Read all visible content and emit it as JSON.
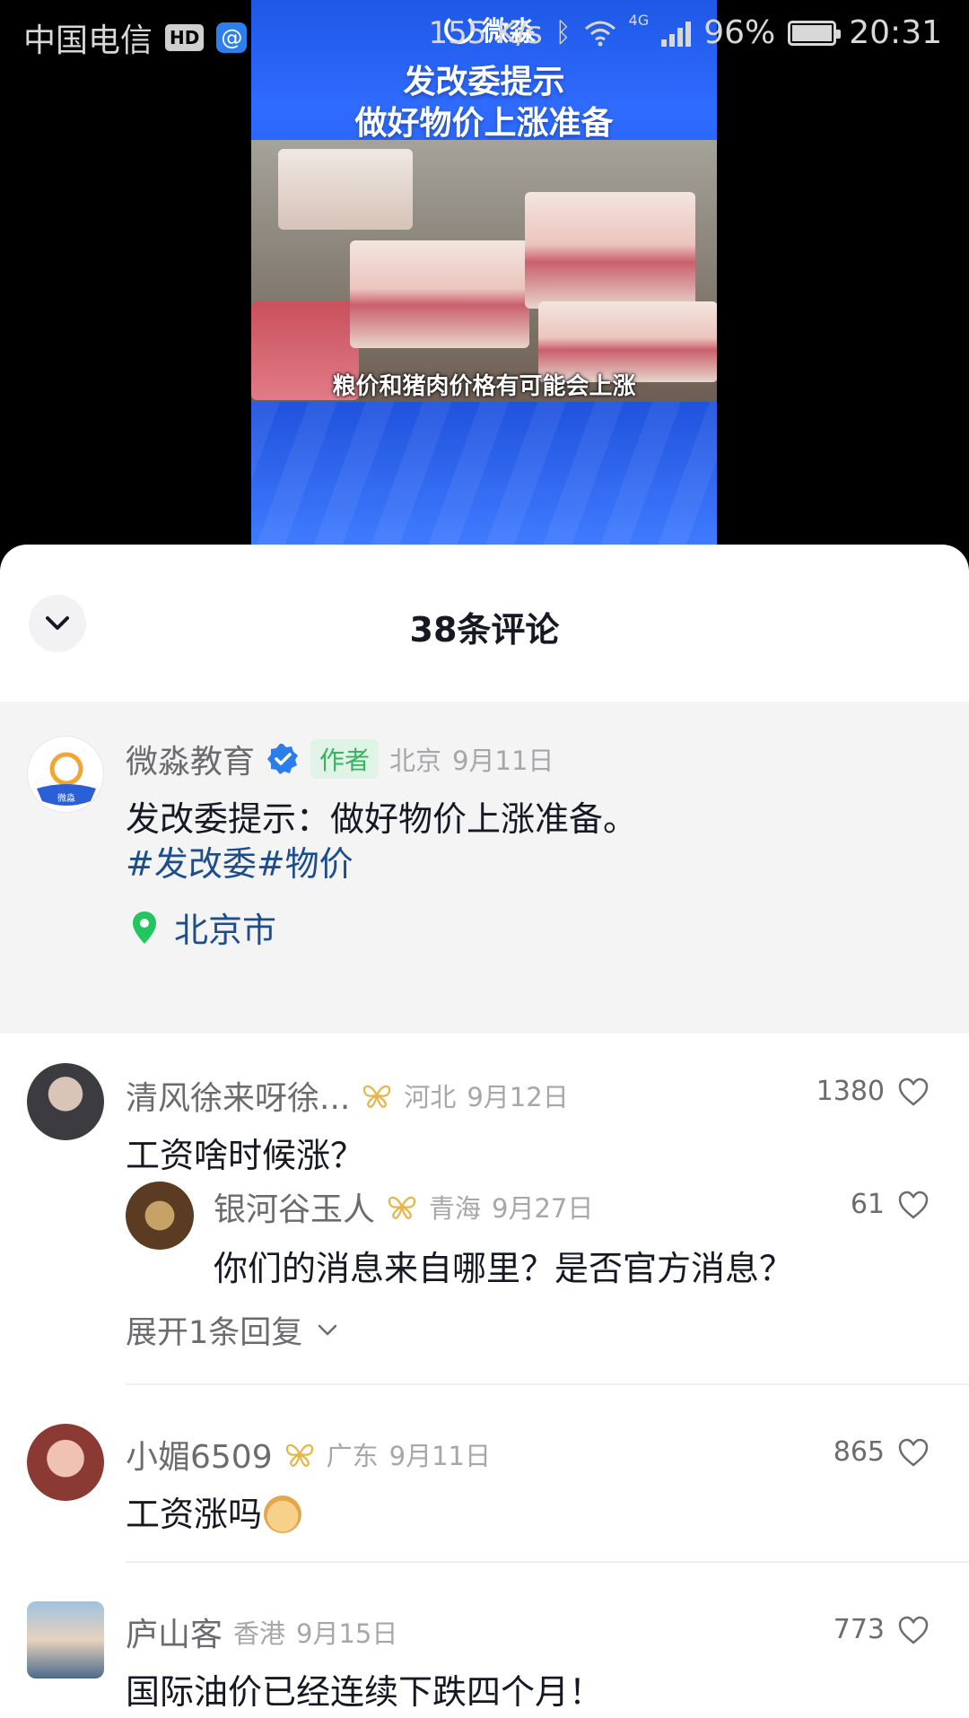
{
  "status_bar": {
    "carrier": "中国电信",
    "hd": "HD",
    "speed": "155 K/s",
    "network": "4G",
    "battery": "96%",
    "time": "20:31"
  },
  "video": {
    "logo": "微淼",
    "title_line1": "发改委提示",
    "title_line2": "做好物价上涨准备",
    "subtitle": "粮价和猪肉价格有可能会上涨"
  },
  "sheet": {
    "title": "38条评论"
  },
  "author_post": {
    "name": "微淼教育",
    "avatar_text": "微淼",
    "tag": "作者",
    "region": "北京",
    "date": "9月11日",
    "text": "发改委提示：做好物价上涨准备。",
    "hashtags": "#发改委#物价",
    "location": "北京市"
  },
  "comments": [
    {
      "name": "清风徐来呀徐...",
      "region": "河北",
      "date": "9月12日",
      "likes": "1380",
      "text": "工资啥时候涨？",
      "reply": {
        "name": "银河谷玉人",
        "region": "青海",
        "date": "9月27日",
        "likes": "61",
        "text": "你们的消息来自哪里？是否官方消息？"
      },
      "expand_label": "展开1条回复"
    },
    {
      "name": "小媚6509",
      "region": "广东",
      "date": "9月11日",
      "likes": "865",
      "text": "工资涨吗"
    },
    {
      "name": "庐山客",
      "region": "香港",
      "date": "9月15日",
      "likes": "773",
      "text": "国际油价已经连续下跌四个月！"
    }
  ],
  "colors": {
    "link_blue": "#1e4d8c",
    "author_green": "#35b35e",
    "verify_blue": "#2b7de9",
    "badge_gold": "#e6b54a"
  }
}
